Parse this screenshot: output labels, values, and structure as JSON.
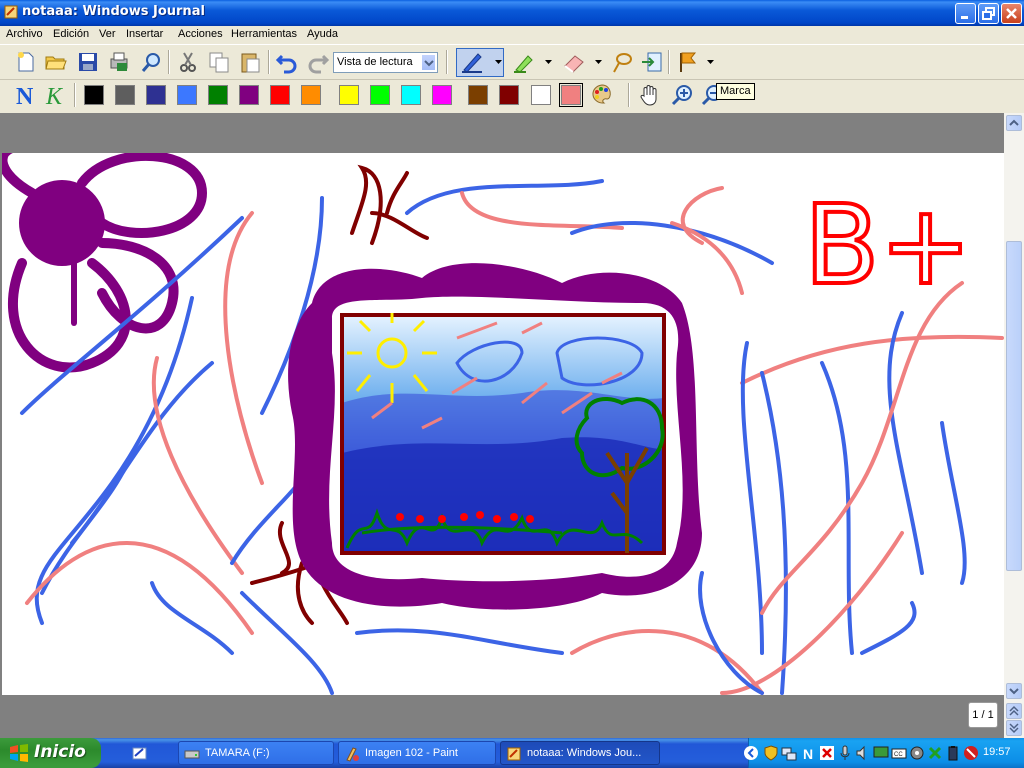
{
  "window": {
    "title": "notaaa: Windows Journal"
  },
  "menu": [
    "Archivo",
    "Edición",
    "Ver",
    "Insertar",
    "Acciones",
    "Herramientas",
    "Ayuda"
  ],
  "toolbar": {
    "view_mode": "Vista de lectura",
    "tooltip": "Marca"
  },
  "colors": {
    "palette": [
      "#000000",
      "#5e5e5e",
      "#2e3192",
      "#3c78ff",
      "#008000",
      "#800080",
      "#ff0000",
      "#ff8c00",
      "#ffff00",
      "#00ff00",
      "#00ffff",
      "#ff00ff",
      "#7b3f00",
      "#800000",
      "#ffffff",
      "#f08080"
    ],
    "accent": "#0054e3"
  },
  "page": {
    "indicator": "1 / 1",
    "drawing_text": "B+"
  },
  "taskbar": {
    "start": "Inicio",
    "tasks": [
      {
        "label": "TAMARA (F:)"
      },
      {
        "label": "Imagen 102 - Paint"
      },
      {
        "label": "notaaa: Windows Jou..."
      }
    ],
    "clock": "19:57"
  }
}
